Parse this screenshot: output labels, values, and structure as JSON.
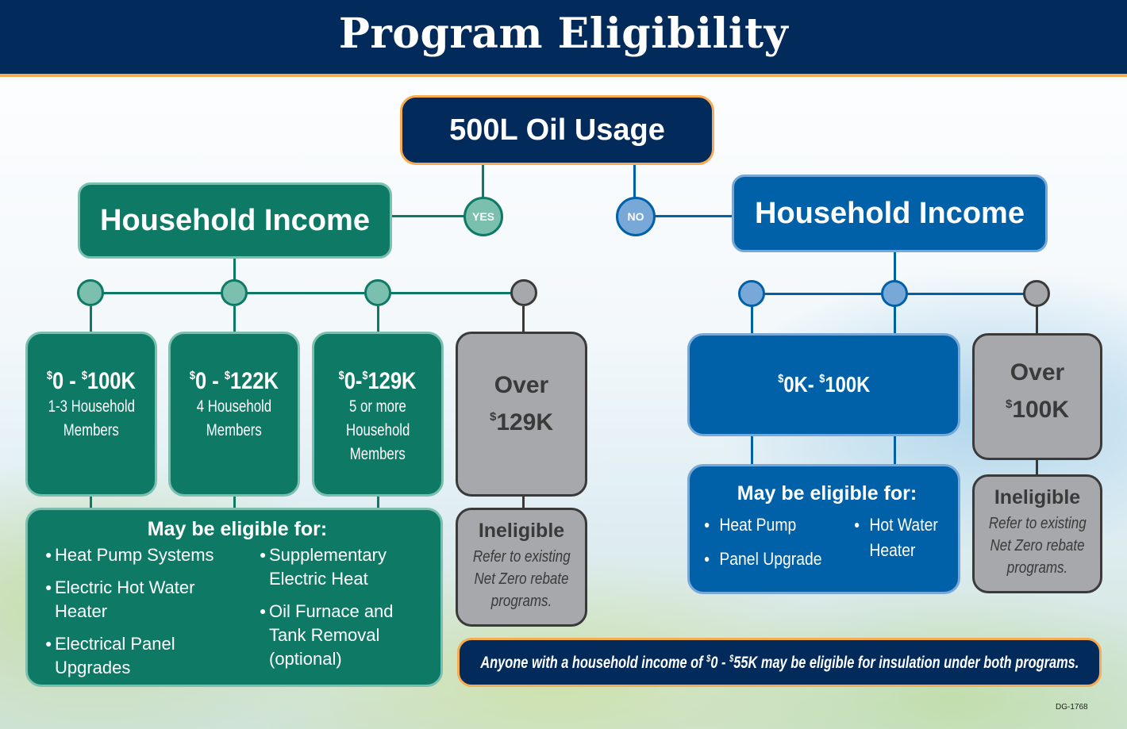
{
  "header": {
    "title": "Program Eligibility"
  },
  "root": {
    "label": "500L Oil Usage"
  },
  "branches": {
    "yes": {
      "badge": "YES",
      "title": "Household Income",
      "color": "#0e7a66",
      "accent": "#7bbfae",
      "tiers": [
        {
          "range_from": "0 - ",
          "range_to": "100K",
          "line1": "1-3 Household",
          "line2": "Members",
          "line3": ""
        },
        {
          "range_from": "0 - ",
          "range_to": "122K",
          "line1": "4 Household",
          "line2": "Members",
          "line3": ""
        },
        {
          "range_from": "0-",
          "range_to": "129K",
          "line1": "5 or more",
          "line2": "Household",
          "line3": "Members"
        }
      ],
      "over": {
        "label": "Over",
        "amount": "129K"
      },
      "eligible": {
        "title": "May be eligible for:",
        "left": [
          "Heat Pump Systems",
          "Electric Hot Water Heater",
          "Electrical Panel Upgrades"
        ],
        "right": [
          "Supplementary Electric Heat",
          "Oil Furnace and Tank Removal (optional)"
        ]
      },
      "ineligible": {
        "title": "Ineligible",
        "line1": "Refer to existing",
        "line2": "Net Zero rebate",
        "line3": "programs."
      }
    },
    "no": {
      "badge": "NO",
      "title": "Household Income",
      "color": "#0060a8",
      "accent": "#78a8d8",
      "tier": {
        "range_from": "0K- ",
        "range_to": "100K"
      },
      "over": {
        "label": "Over",
        "amount": "100K"
      },
      "eligible": {
        "title": "May be eligible for:",
        "left": [
          "Heat Pump",
          "Panel Upgrade"
        ],
        "right": [
          "Hot Water",
          "Heater"
        ]
      },
      "ineligible": {
        "title": "Ineligible",
        "line1": "Refer to existing",
        "line2": "Net Zero rebate",
        "line3": "programs."
      }
    }
  },
  "note": {
    "prefix": "Anyone with a household income of ",
    "from": "0 - ",
    "to": "55K may be eligible for insulation under both programs."
  },
  "currency_symbol": "$",
  "doc_code": "DG-1768",
  "colors": {
    "navy": "#022a5a",
    "orange": "#f6ac52",
    "grey": "#a7a8ab",
    "dark": "#3a3a3a"
  }
}
